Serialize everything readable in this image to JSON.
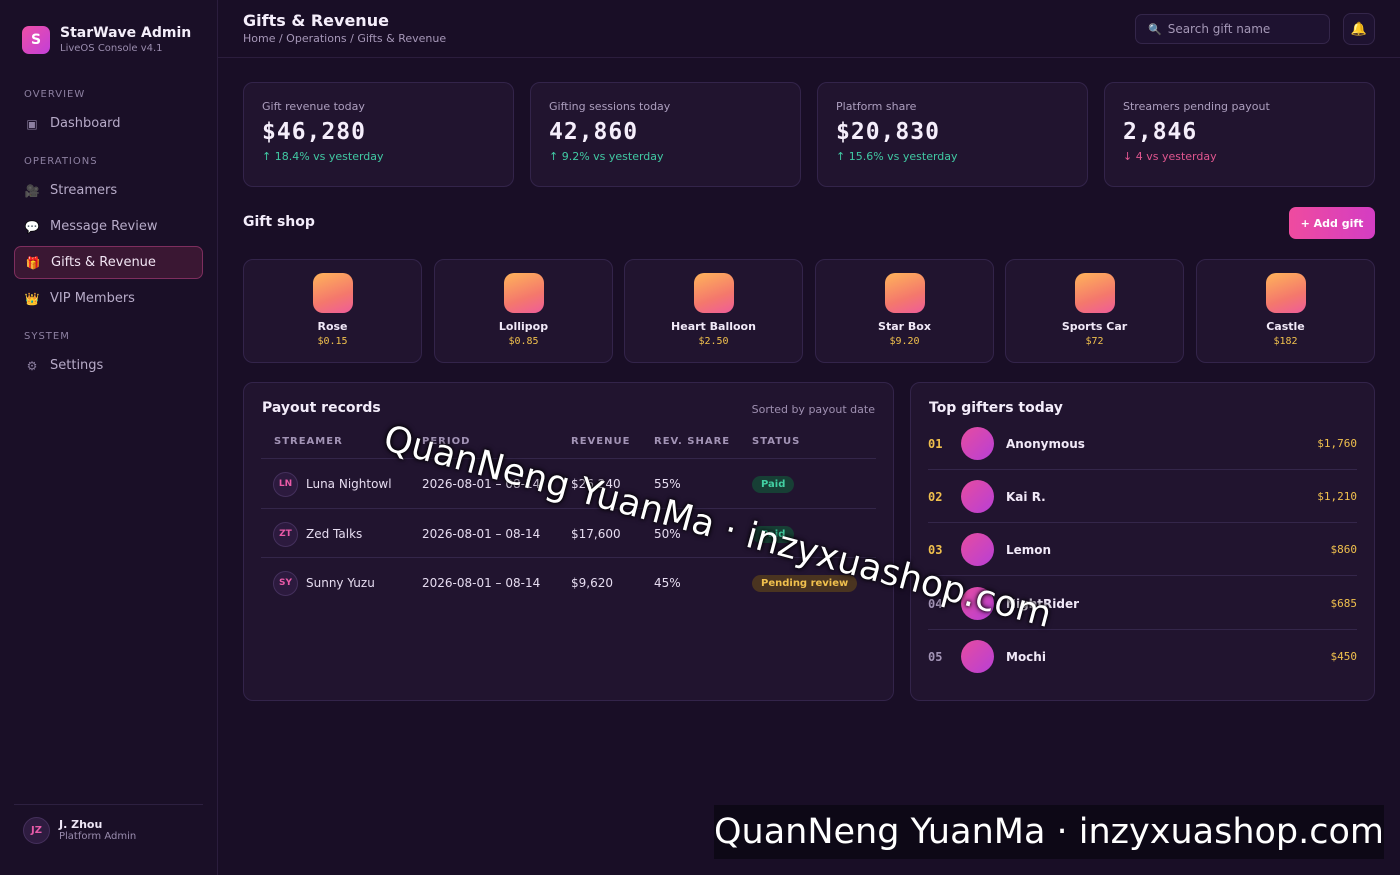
{
  "brand": {
    "logo_letter": "S",
    "title": "StarWave Admin",
    "subtitle": "LiveOS Console v4.1"
  },
  "sidebar": {
    "sections": [
      "OVERVIEW",
      "OPERATIONS",
      "SYSTEM"
    ],
    "items": [
      {
        "label": "Dashboard",
        "icon": "dashboard-icon",
        "glyph": "▣"
      },
      {
        "label": "Streamers",
        "icon": "camera-icon",
        "glyph": "🎥"
      },
      {
        "label": "Message Review",
        "icon": "chat-bubble-icon",
        "glyph": "💬"
      },
      {
        "label": "Gifts & Revenue",
        "icon": "gift-icon",
        "glyph": "🎁",
        "active": true
      },
      {
        "label": "VIP Members",
        "icon": "crown-icon",
        "glyph": "👑"
      },
      {
        "label": "Settings",
        "icon": "gear-icon",
        "glyph": "⚙"
      }
    ],
    "user": {
      "initials": "JZ",
      "name": "J. Zhou",
      "role": "Platform Admin"
    }
  },
  "header": {
    "title": "Gifts & Revenue",
    "breadcrumb": "Home / Operations / Gifts & Revenue",
    "search_placeholder": "Search gift name",
    "search_glyph": "🔍",
    "bell_glyph": "🔔"
  },
  "stats": [
    {
      "label": "Gift revenue today",
      "value": "$46,280",
      "delta": "↑ 18.4% vs yesterday",
      "trend": "up"
    },
    {
      "label": "Gifting sessions today",
      "value": "42,860",
      "delta": "↑ 9.2% vs yesterday",
      "trend": "up"
    },
    {
      "label": "Platform share",
      "value": "$20,830",
      "delta": "↑ 15.6% vs yesterday",
      "trend": "up"
    },
    {
      "label": "Streamers pending payout",
      "value": "2,846",
      "delta": "↓ 4 vs yesterday",
      "trend": "down"
    }
  ],
  "gift_shop": {
    "title": "Gift shop",
    "add_label": "+ Add gift",
    "gifts": [
      {
        "name": "Rose",
        "price": "$0.15"
      },
      {
        "name": "Lollipop",
        "price": "$0.85"
      },
      {
        "name": "Heart Balloon",
        "price": "$2.50"
      },
      {
        "name": "Star Box",
        "price": "$9.20"
      },
      {
        "name": "Sports Car",
        "price": "$72"
      },
      {
        "name": "Castle",
        "price": "$182"
      }
    ]
  },
  "payouts": {
    "title": "Payout records",
    "note": "Sorted by payout date",
    "columns": [
      "STREAMER",
      "PERIOD",
      "REVENUE",
      "REV. SHARE",
      "STATUS"
    ],
    "rows": [
      {
        "initials": "LN",
        "streamer": "Luna Nightowl",
        "period": "2026-08-01 – 08-14",
        "revenue": "$26,240",
        "share": "55%",
        "status": "Paid",
        "status_type": "paid"
      },
      {
        "initials": "ZT",
        "streamer": "Zed Talks",
        "period": "2026-08-01 – 08-14",
        "revenue": "$17,600",
        "share": "50%",
        "status": "Paid",
        "status_type": "paid"
      },
      {
        "initials": "SY",
        "streamer": "Sunny Yuzu",
        "period": "2026-08-01 – 08-14",
        "revenue": "$9,620",
        "share": "45%",
        "status": "Pending review",
        "status_type": "pending"
      }
    ]
  },
  "top_gifters": {
    "title": "Top gifters today",
    "entries": [
      {
        "rank": "01",
        "name": "Anonymous",
        "amount": "$1,760",
        "highlight": true
      },
      {
        "rank": "02",
        "name": "Kai R.",
        "amount": "$1,210",
        "highlight": true
      },
      {
        "rank": "03",
        "name": "Lemon",
        "amount": "$860",
        "highlight": true
      },
      {
        "rank": "04",
        "name": "NightRider",
        "amount": "$685",
        "highlight": false
      },
      {
        "rank": "05",
        "name": "Mochi",
        "amount": "$450",
        "highlight": false
      }
    ]
  },
  "watermark": {
    "text": "QuanNeng YuanMa · inzyxuashop.com"
  },
  "colors": {
    "accent": "#ee4fa6",
    "gold": "#f0c04d",
    "up": "#41c9a3",
    "down": "#e0568f",
    "bg": "#190e26"
  }
}
